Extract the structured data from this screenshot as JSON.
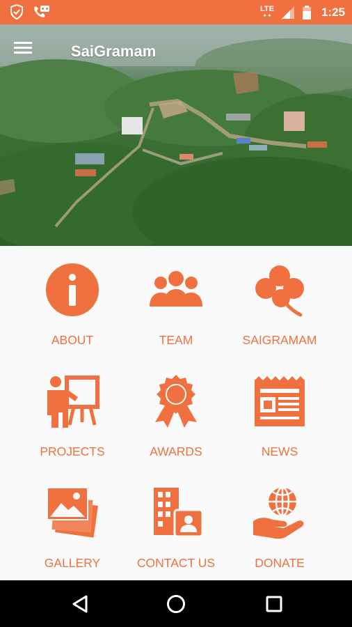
{
  "status_bar": {
    "network": "LTE",
    "time": "1:25",
    "icons": [
      "shield-check-icon",
      "voicemail-icon",
      "signal-icon",
      "battery-icon"
    ]
  },
  "app_bar": {
    "title": "SaiGramam",
    "menu_icon": "hamburger-menu-icon"
  },
  "theme": {
    "accent": "#f07040",
    "background": "#fafafa",
    "nav_bar": "#000000"
  },
  "menu": [
    {
      "label": "ABOUT",
      "icon": "info-icon"
    },
    {
      "label": "TEAM",
      "icon": "team-icon"
    },
    {
      "label": "SAIGRAMAM",
      "icon": "clover-icon"
    },
    {
      "label": "PROJECTS",
      "icon": "presentation-icon"
    },
    {
      "label": "AWARDS",
      "icon": "award-icon"
    },
    {
      "label": "NEWS",
      "icon": "newspaper-icon"
    },
    {
      "label": "GALLERY",
      "icon": "gallery-icon"
    },
    {
      "label": "CONTACT US",
      "icon": "contact-icon"
    },
    {
      "label": "DONATE",
      "icon": "donate-icon"
    }
  ],
  "nav_bar": {
    "buttons": [
      "back-icon",
      "home-icon",
      "recents-icon"
    ]
  }
}
